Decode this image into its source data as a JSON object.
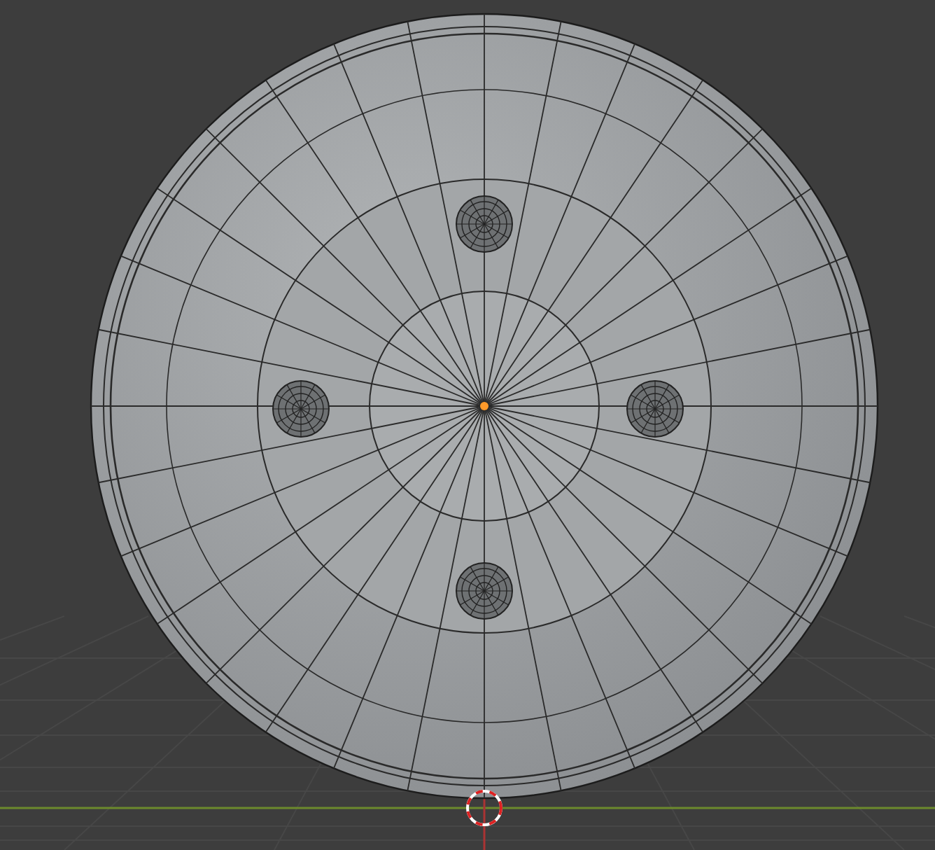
{
  "viewport": {
    "show_grid": true,
    "show_cursor": true,
    "object_selected": false
  }
}
